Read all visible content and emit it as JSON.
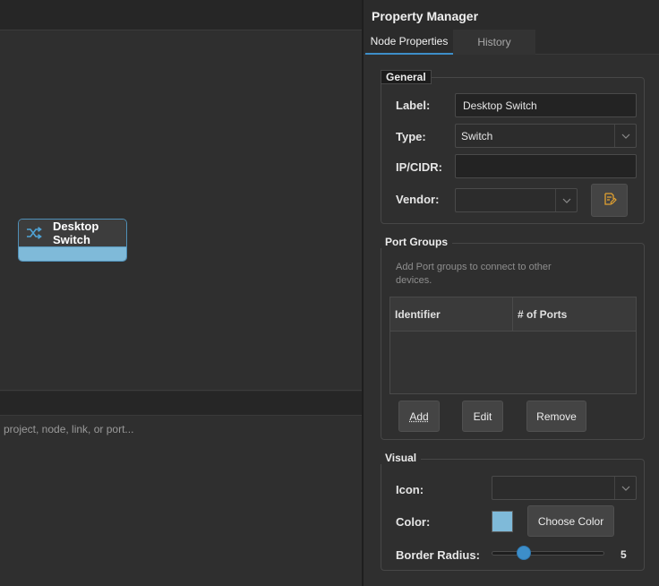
{
  "canvas": {
    "node": {
      "title": "Desktop Switch",
      "icon": "shuffle-icon",
      "bar_color": "#7fbad9"
    },
    "search_placeholder": "project, node, link, or port..."
  },
  "panel": {
    "title": "Property Manager",
    "tabs": [
      {
        "label": "Node Properties",
        "active": true
      },
      {
        "label": "History",
        "active": false
      }
    ],
    "general": {
      "title": "General",
      "label_label": "Label:",
      "label_value": "Desktop Switch",
      "type_label": "Type:",
      "type_value": "Switch",
      "ip_label": "IP/CIDR:",
      "ip_value": "",
      "vendor_label": "Vendor:",
      "vendor_value": ""
    },
    "port_groups": {
      "title": "Port Groups",
      "hint": "Add Port groups to connect to other devices.",
      "columns": [
        "Identifier",
        "# of Ports"
      ],
      "rows": [],
      "add_label": "Add",
      "edit_label": "Edit",
      "remove_label": "Remove"
    },
    "visual": {
      "title": "Visual",
      "icon_label": "Icon:",
      "icon_value": "",
      "color_label": "Color:",
      "color_value": "#7fbad9",
      "choose_color_label": "Choose Color",
      "border_radius_label": "Border Radius:",
      "border_radius_value": "5",
      "border_radius_max": 20
    }
  },
  "colors": {
    "accent": "#3d8ec9",
    "node_border": "#4f8fb7"
  }
}
